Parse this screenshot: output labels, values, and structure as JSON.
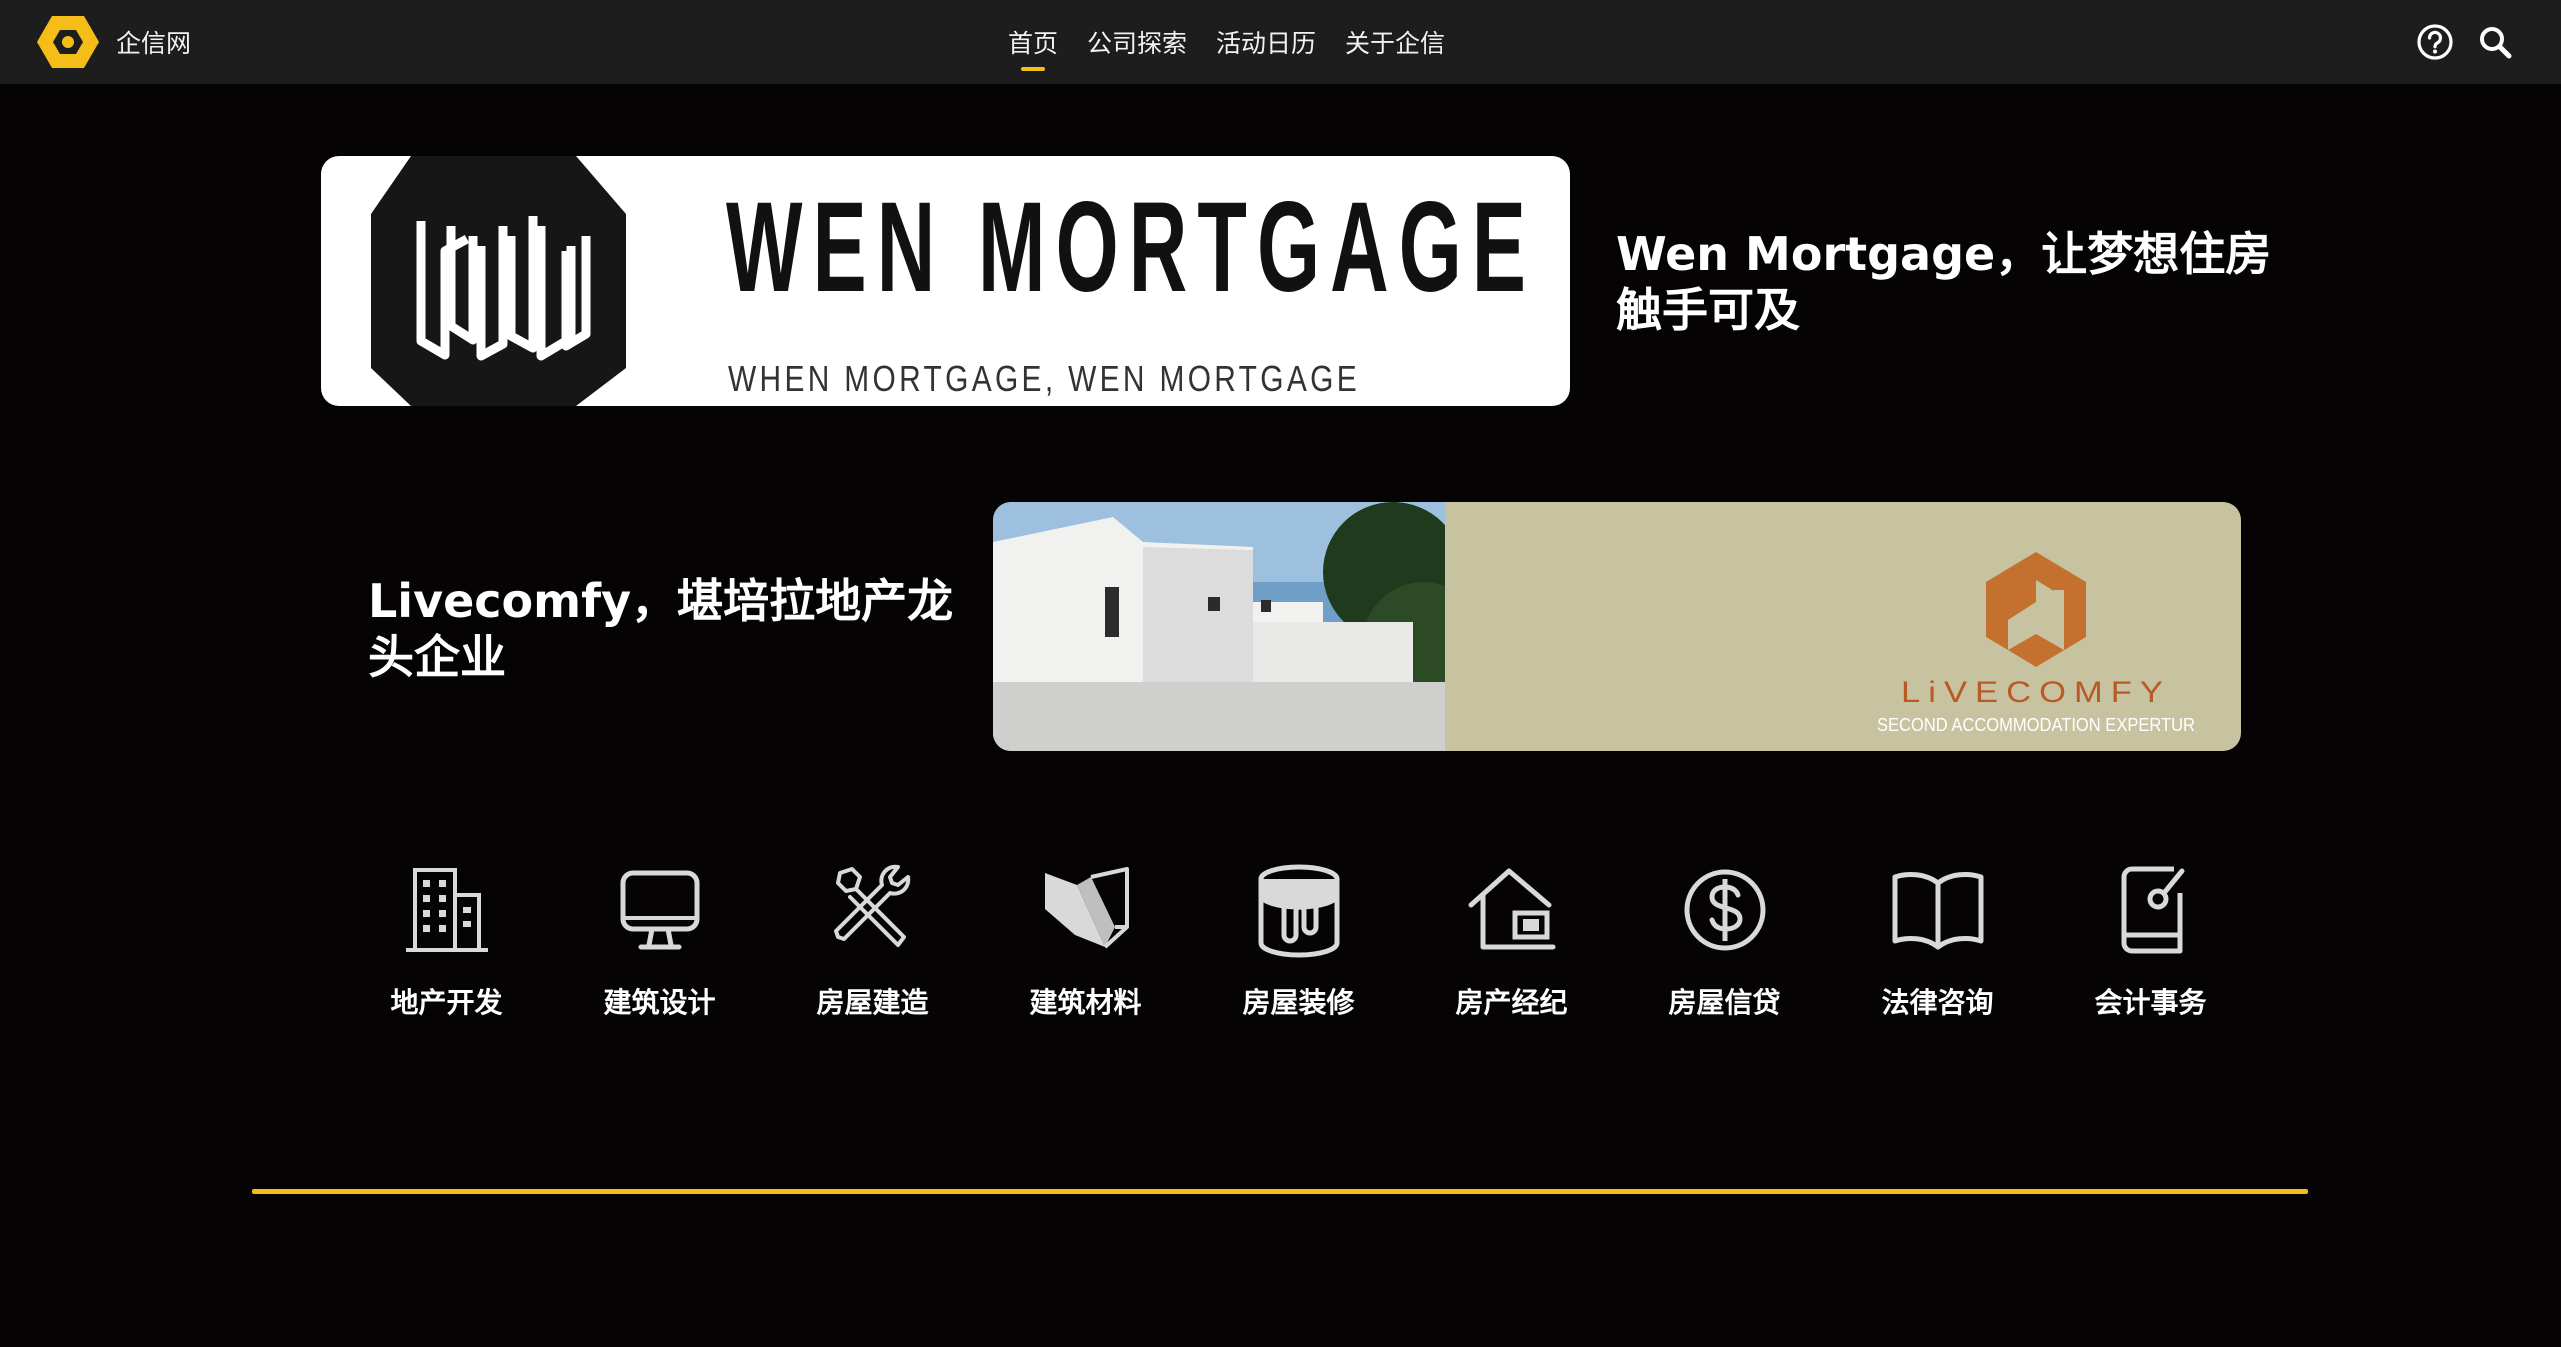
{
  "header": {
    "brand_name": "企信网",
    "brand_color": "#f5bd17",
    "nav": [
      {
        "label": "首页",
        "active": true
      },
      {
        "label": "公司探索",
        "active": false
      },
      {
        "label": "活动日历",
        "active": false
      },
      {
        "label": "关于企信",
        "active": false
      }
    ],
    "icons": [
      "help-icon",
      "search-icon"
    ]
  },
  "banners": [
    {
      "title": "Wen Mortgage，让梦想住房触手可及",
      "logo_text": "WEN MORTGAGE",
      "logo_tagline": "WHEN MORTGAGE, WEN MORTGAGE"
    },
    {
      "title": "Livecomfy，堪培拉地产龙头企业",
      "logo_text": "LiVECOMFY",
      "logo_tagline": "SECOND ACCOMMODATION EXPERTUR"
    }
  ],
  "categories": [
    {
      "label": "地产开发",
      "icon": "building-icon"
    },
    {
      "label": "建筑设计",
      "icon": "monitor-icon"
    },
    {
      "label": "房屋建造",
      "icon": "tools-icon"
    },
    {
      "label": "建筑材料",
      "icon": "materials-icon"
    },
    {
      "label": "房屋装修",
      "icon": "paint-bucket-icon"
    },
    {
      "label": "房产经纪",
      "icon": "house-agent-icon"
    },
    {
      "label": "房屋信贷",
      "icon": "dollar-icon"
    },
    {
      "label": "法律咨询",
      "icon": "book-icon"
    },
    {
      "label": "会计事务",
      "icon": "ledger-icon"
    }
  ],
  "colors": {
    "accent": "#f5bd17",
    "background": "#050303",
    "topbar": "#1d1d1d",
    "livecomfy_orange": "#c4702e",
    "livecomfy_bg": "#c7c3a1"
  }
}
